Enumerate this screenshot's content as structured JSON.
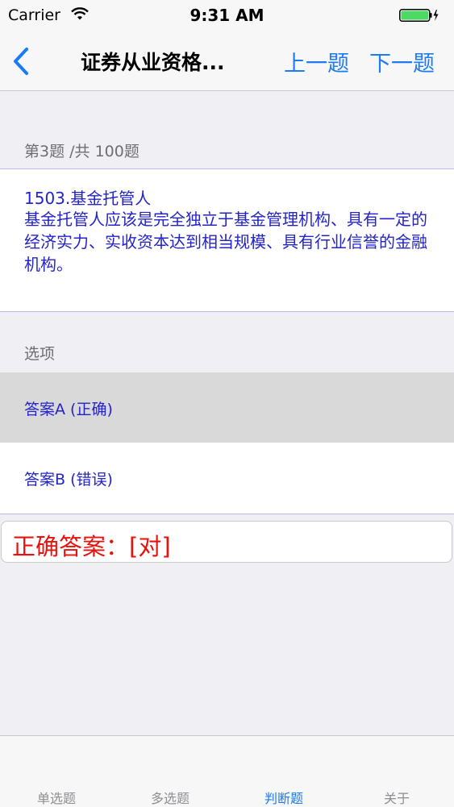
{
  "status_bar": {
    "carrier": "Carrier",
    "time": "9:31 AM"
  },
  "nav": {
    "title": "证券从业资格...",
    "prev_label": "上一题",
    "next_label": "下一题",
    "accent_color": "#1b7bf5"
  },
  "question": {
    "progress": "第3题 /共 100题",
    "title": "1503.基金托管人",
    "body": "基金托管人应该是完全独立于基金管理机构、具有一定的经济实力、实收资本达到相当规模、具有行业信誉的金融机构。"
  },
  "options": {
    "header": "选项",
    "items": [
      {
        "label": "答案A (正确)",
        "selected": true
      },
      {
        "label": "答案B (错误)",
        "selected": false
      }
    ]
  },
  "answer": {
    "text": "正确答案：[对]",
    "color": "#e8110c"
  },
  "tabs": [
    {
      "label": "单选题",
      "active": false
    },
    {
      "label": "多选题",
      "active": false
    },
    {
      "label": "判断题",
      "active": true
    },
    {
      "label": "关于",
      "active": false
    }
  ]
}
